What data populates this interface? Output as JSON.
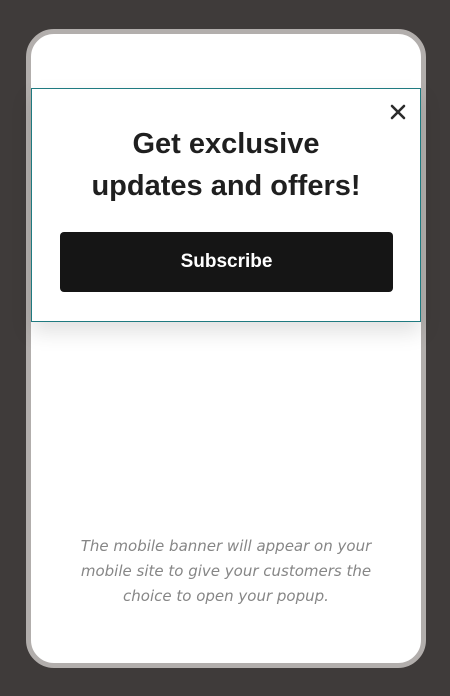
{
  "banner": {
    "headline_line1": "Get exclusive",
    "headline_line2": "updates and offers!",
    "subscribe_label": "Subscribe",
    "close_icon": "close-icon"
  },
  "caption": {
    "text": "The mobile banner will appear on your mobile site to give your customers the choice to open your popup."
  },
  "colors": {
    "background": "#3f3b3a",
    "phone_frame": "#b2aeac",
    "banner_border": "#1f7a80",
    "button": "#151515",
    "caption_text": "#868686"
  }
}
